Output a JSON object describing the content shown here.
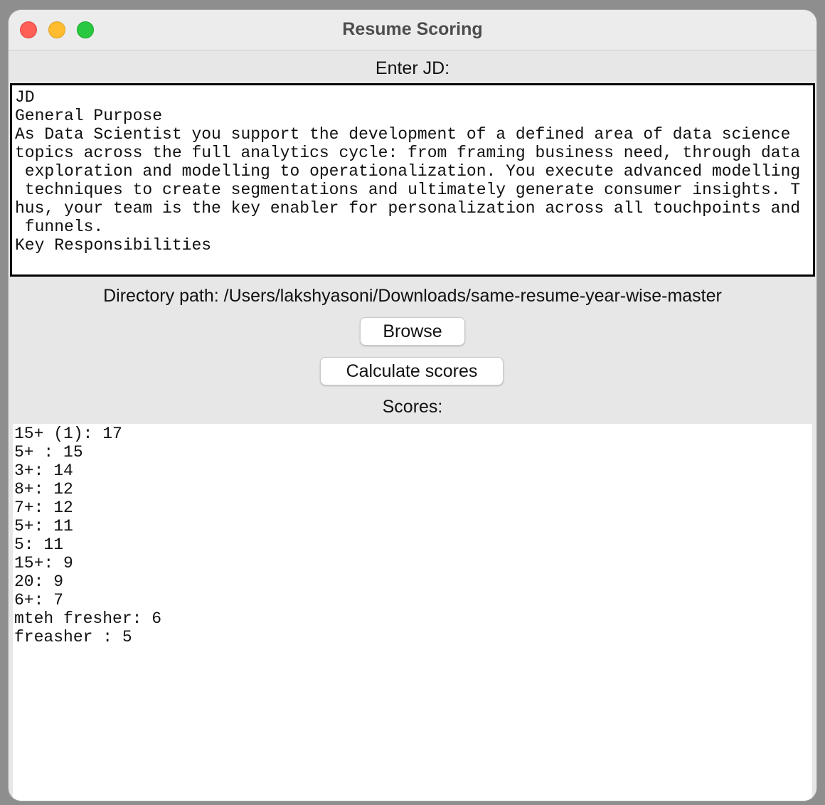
{
  "window": {
    "title": "Resume Scoring"
  },
  "jd": {
    "label": "Enter JD:",
    "text": "JD\nGeneral Purpose\nAs Data Scientist you support the development of a defined area of data science \ntopics across the full analytics cycle: from framing business need, through data\n exploration and modelling to operationalization. You execute advanced modelling\n techniques to create segmentations and ultimately generate consumer insights. T\nhus, your team is the key enabler for personalization across all touchpoints and\n funnels.\nKey Responsibilities"
  },
  "directory": {
    "label": "Directory path: /Users/lakshyasoni/Downloads/same-resume-year-wise-master"
  },
  "buttons": {
    "browse": "Browse",
    "calculate": "Calculate scores"
  },
  "scores": {
    "label": "Scores:",
    "items": [
      "15+ (1): 17",
      "5+ : 15",
      "3+: 14",
      "8+: 12",
      "7+: 12",
      "5+: 11",
      "5: 11",
      "15+: 9",
      "20: 9",
      "6+: 7",
      "mteh fresher: 6",
      "freasher : 5"
    ]
  }
}
